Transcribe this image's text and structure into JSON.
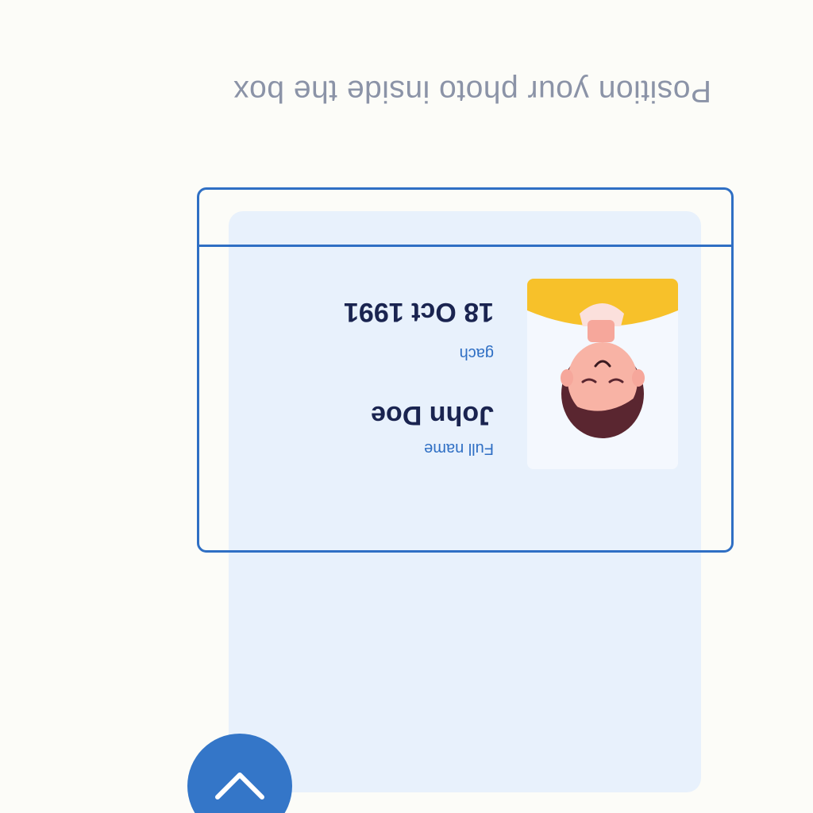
{
  "instruction": {
    "text": "Position your photo inside the box"
  },
  "id_card": {
    "photo_icon": "portrait-avatar",
    "name_label": "Full name",
    "name_value": "John Doe",
    "dob_label": "gach",
    "dob_value": "18 Oct 1991"
  },
  "fab": {
    "icon": "chevron-down-icon"
  },
  "colors": {
    "accent": "#2f6fc4",
    "card_background": "#e8f1fc",
    "page_background": "#fcfcf8",
    "text_dark": "#1a2450",
    "text_muted": "#8b93a7",
    "avatar_shirt": "#f7c12a"
  }
}
